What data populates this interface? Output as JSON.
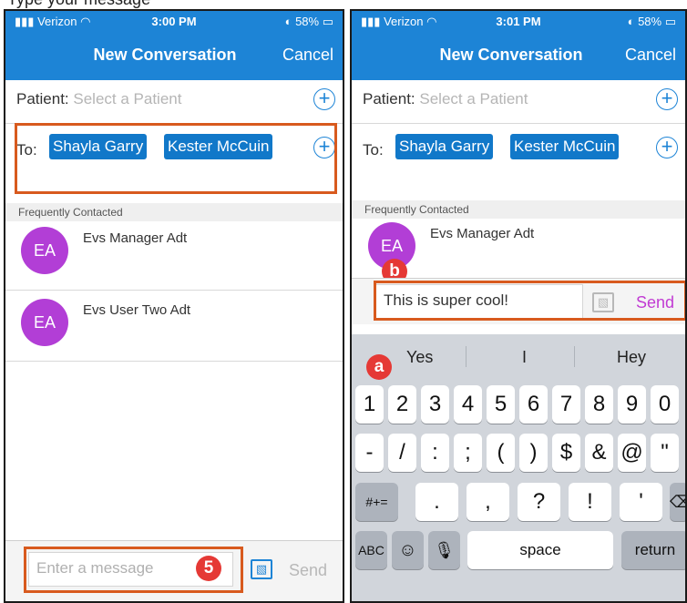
{
  "caption_text": "Type your message",
  "left": {
    "status": {
      "carrier": "Verizon",
      "time": "3:00 PM",
      "battery": "58%"
    },
    "nav": {
      "title": "New Conversation",
      "cancel": "Cancel"
    },
    "patient_label": "Patient:",
    "patient_placeholder": "Select a Patient",
    "to_label": "To:",
    "recipients": [
      "Shayla Garry",
      "Kester McCuin"
    ],
    "section": "Frequently Contacted",
    "contacts": [
      {
        "initials": "EA",
        "name": "Evs Manager Adt"
      },
      {
        "initials": "EA",
        "name": "Evs User Two Adt"
      }
    ],
    "message_placeholder": "Enter a message",
    "badge": "5",
    "send": "Send"
  },
  "right": {
    "status": {
      "carrier": "Verizon",
      "time": "3:01 PM",
      "battery": "58%"
    },
    "nav": {
      "title": "New Conversation",
      "cancel": "Cancel"
    },
    "patient_label": "Patient:",
    "patient_placeholder": "Select a Patient",
    "to_label": "To:",
    "recipients": [
      "Shayla Garry",
      "Kester McCuin"
    ],
    "section": "Frequently Contacted",
    "contact": {
      "initials": "EA",
      "name": "Evs Manager Adt"
    },
    "message": "This is super cool!",
    "send": "Send",
    "badge_b": "b",
    "badge_a": "a",
    "suggestions": [
      "Yes",
      "I",
      "Hey"
    ],
    "keys": {
      "numbers": [
        "1",
        "2",
        "3",
        "4",
        "5",
        "6",
        "7",
        "8",
        "9",
        "0"
      ],
      "symbols": [
        "-",
        "/",
        ":",
        ";",
        "(",
        ")",
        "$",
        "&",
        "@",
        "\""
      ],
      "row3": [
        ".",
        ",",
        "?",
        "!",
        "'"
      ],
      "more": "#+=",
      "abc": "ABC",
      "space": "space",
      "return": "return"
    }
  },
  "colors": {
    "brand": "#1d84d6",
    "chip": "#1178c9",
    "avatar": "#b23ed6",
    "highlight": "#d85a1e",
    "badge": "#e53935",
    "send_active": "#c13bd3"
  }
}
